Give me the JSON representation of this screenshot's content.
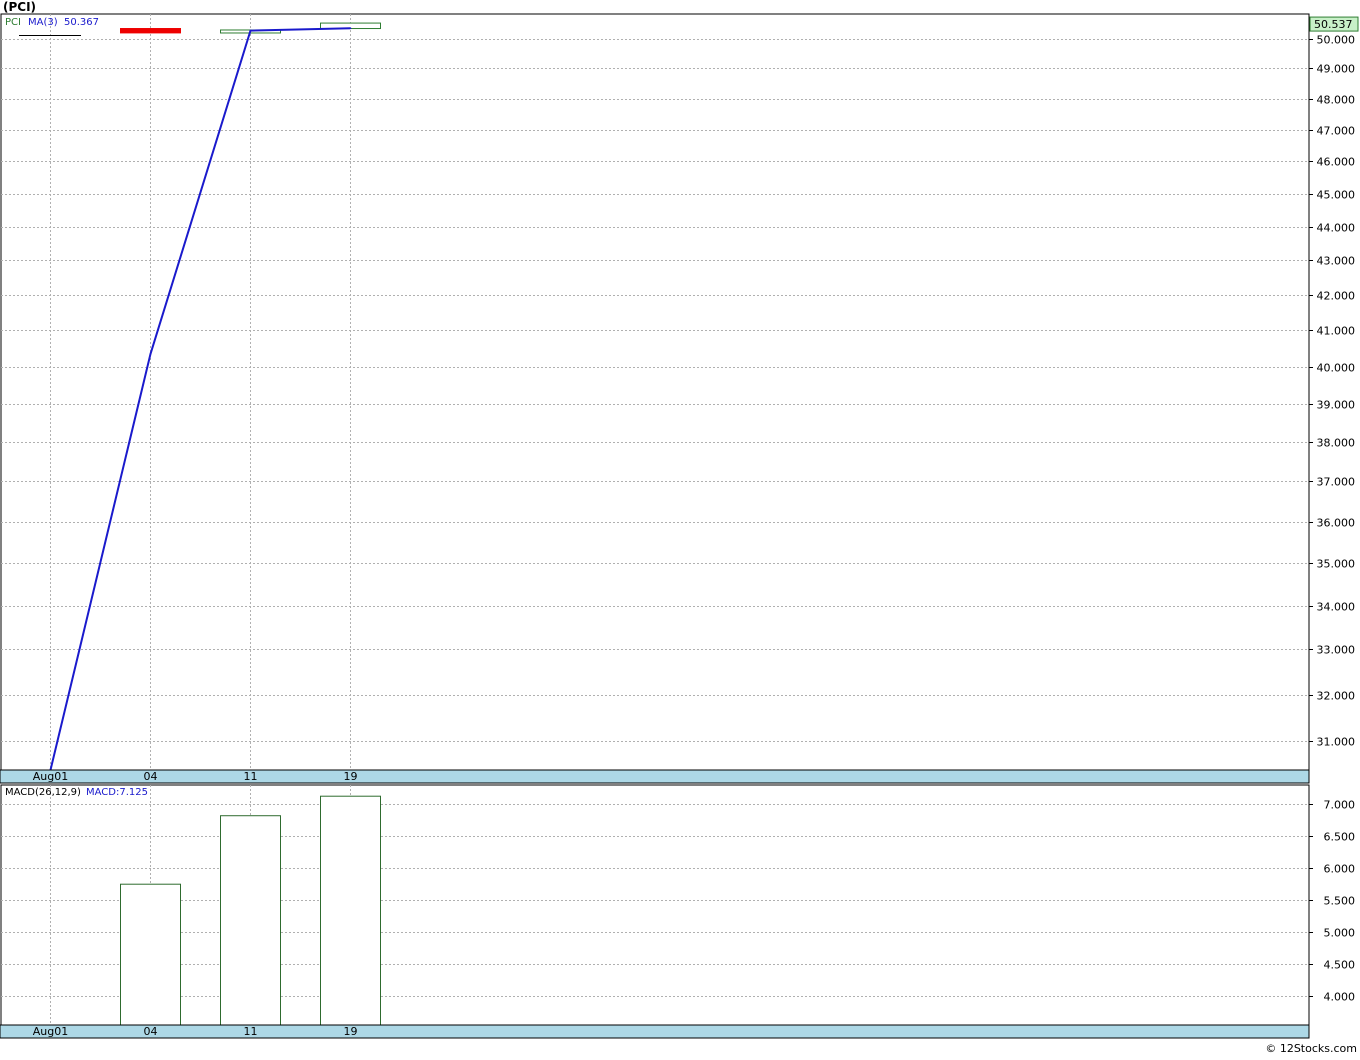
{
  "header": {
    "title": "(PCI)"
  },
  "footer": {
    "credit": "© 12Stocks.com"
  },
  "x_labels": [
    "Aug01",
    "04",
    "11",
    "19"
  ],
  "chart_data": [
    {
      "type": "line",
      "panel": "price",
      "symbol": "PCI",
      "legend": {
        "ticker": "PCI",
        "indicator": "MA(3)",
        "indicator_value": "50.367"
      },
      "x": [
        "Aug01",
        "04",
        "11",
        "19"
      ],
      "candles": [
        {
          "x": "04",
          "open": 50.35,
          "close": 50.2,
          "high": 50.35,
          "low": 50.2,
          "direction": "down"
        },
        {
          "x": "11",
          "open": 50.25,
          "close": 50.3,
          "high": 50.3,
          "low": 50.25,
          "direction": "up"
        },
        {
          "x": "19",
          "open": 50.35,
          "close": 50.537,
          "high": 50.537,
          "low": 50.35,
          "direction": "up"
        }
      ],
      "series": [
        {
          "name": "MA(3)",
          "values": [
            30.4,
            40.35,
            50.28,
            50.36
          ]
        }
      ],
      "yticks": [
        31,
        32,
        33,
        34,
        35,
        36,
        37,
        38,
        39,
        40,
        41,
        42,
        43,
        44,
        45,
        46,
        47,
        48,
        49,
        50
      ],
      "y_tick_labels": [
        "31.000",
        "32.000",
        "33.000",
        "34.000",
        "35.000",
        "36.000",
        "37.000",
        "38.000",
        "39.000",
        "40.000",
        "41.000",
        "42.000",
        "43.000",
        "44.000",
        "45.000",
        "46.000",
        "47.000",
        "48.000",
        "49.000",
        "50.000"
      ],
      "last_price_label": "50.537",
      "last_price": 50.537,
      "ylim": [
        30.4,
        50.85
      ],
      "y_scale": "log",
      "grid": true,
      "colors": {
        "ma": "#1a1acc",
        "down": "#ee0000",
        "up": "#2e7d32",
        "axis_band": "#add8e6"
      }
    },
    {
      "type": "bar",
      "panel": "indicator",
      "legend": {
        "name": "MACD(26,12,9)",
        "value_label": "MACD:7.125"
      },
      "categories": [
        "Aug01",
        "04",
        "11",
        "19"
      ],
      "values": [
        null,
        5.75,
        6.82,
        7.125
      ],
      "yticks": [
        4.0,
        4.5,
        5.0,
        5.5,
        6.0,
        6.5,
        7.0
      ],
      "y_tick_labels": [
        "4.000",
        "4.500",
        "5.000",
        "5.500",
        "6.000",
        "6.500",
        "7.000"
      ],
      "ylim": [
        3.55,
        7.3
      ],
      "grid": true,
      "colors": {
        "bar": "#2e6b2e",
        "axis_band": "#add8e6"
      }
    }
  ]
}
